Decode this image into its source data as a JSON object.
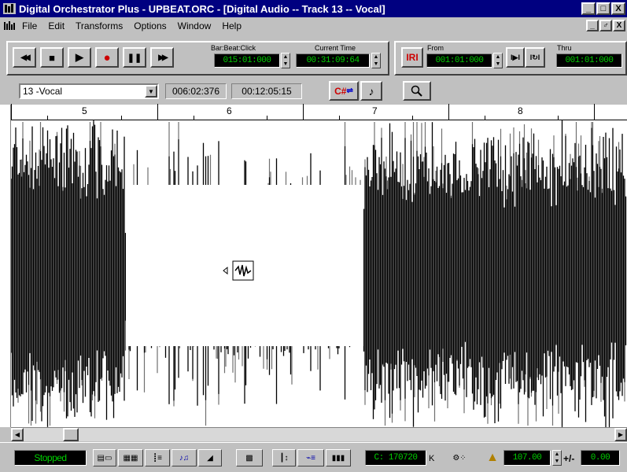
{
  "window": {
    "title": "Digital Orchestrator Plus - UPBEAT.ORC - [Digital Audio -- Track 13 -- Vocal]",
    "buttons": [
      "_",
      "□",
      "X"
    ]
  },
  "menu": {
    "items": [
      "File",
      "Edit",
      "Transforms",
      "Options",
      "Window",
      "Help"
    ],
    "mdi_buttons": [
      "_",
      "♂",
      "X"
    ]
  },
  "transport": {
    "buttons": [
      {
        "name": "rewind",
        "glyph": "◀◀"
      },
      {
        "name": "stop",
        "glyph": "■"
      },
      {
        "name": "play",
        "glyph": "▶"
      },
      {
        "name": "record",
        "glyph": "●"
      },
      {
        "name": "pause",
        "glyph": "❚❚"
      },
      {
        "name": "fast-forward",
        "glyph": "▶▶"
      }
    ],
    "barbeat_label": "Bar:Beat:Click",
    "barbeat_value": "015:01:000",
    "current_time_label": "Current Time",
    "current_time_value": "00:31:09:64",
    "rb_label": "R",
    "from_label": "From",
    "from_value": "001:01:000",
    "thru_label": "Thru",
    "thru_value": "001:01:000"
  },
  "trackbar": {
    "track_select": "13 -Vocal",
    "position_value": "006:02:376",
    "time_value": "00:12:05:15",
    "key_button": "C#",
    "note_glyph": "♪",
    "zoom_glyph": "🔍"
  },
  "ruler": {
    "marks": [
      "5",
      "6",
      "7",
      "8"
    ]
  },
  "status": {
    "state": "Stopped",
    "counter": "C: 170720",
    "counter_unit": "K",
    "tempo": "107.00",
    "tempo_offset_label": "+/-",
    "offset_value": "0.00"
  },
  "colors": {
    "titlebar": "#000080",
    "lcd_text": "#00d000",
    "lcd_bg": "#000000",
    "record": "#cc0000"
  }
}
